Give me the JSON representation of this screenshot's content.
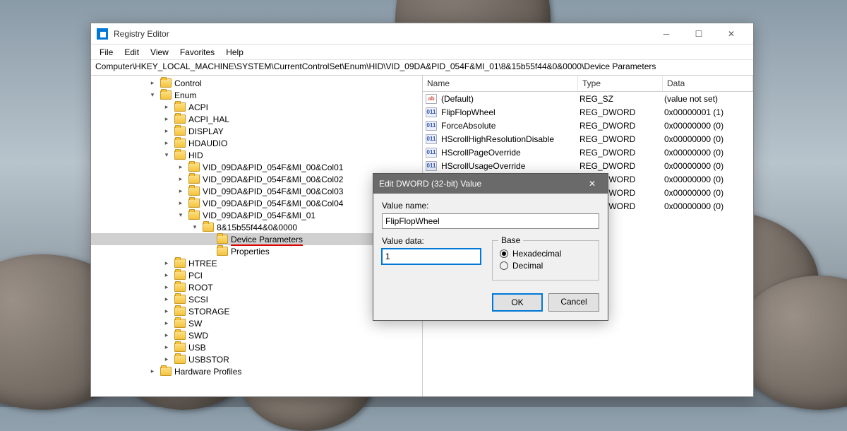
{
  "window": {
    "title": "Registry Editor",
    "menu": [
      "File",
      "Edit",
      "View",
      "Favorites",
      "Help"
    ],
    "path": "Computer\\HKEY_LOCAL_MACHINE\\SYSTEM\\CurrentControlSet\\Enum\\HID\\VID_09DA&PID_054F&MI_01\\8&15b55f44&0&0000\\Device Parameters"
  },
  "tree": {
    "root_indent": 60,
    "items": [
      {
        "label": "Control",
        "indent": 80,
        "toggle": "▸"
      },
      {
        "label": "Enum",
        "indent": 80,
        "toggle": "▾"
      },
      {
        "label": "ACPI",
        "indent": 100,
        "toggle": "▸"
      },
      {
        "label": "ACPI_HAL",
        "indent": 100,
        "toggle": "▸"
      },
      {
        "label": "DISPLAY",
        "indent": 100,
        "toggle": "▸"
      },
      {
        "label": "HDAUDIO",
        "indent": 100,
        "toggle": "▸"
      },
      {
        "label": "HID",
        "indent": 100,
        "toggle": "▾"
      },
      {
        "label": "VID_09DA&PID_054F&MI_00&Col01",
        "indent": 120,
        "toggle": "▸"
      },
      {
        "label": "VID_09DA&PID_054F&MI_00&Col02",
        "indent": 120,
        "toggle": "▸"
      },
      {
        "label": "VID_09DA&PID_054F&MI_00&Col03",
        "indent": 120,
        "toggle": "▸"
      },
      {
        "label": "VID_09DA&PID_054F&MI_00&Col04",
        "indent": 120,
        "toggle": "▸"
      },
      {
        "label": "VID_09DA&PID_054F&MI_01",
        "indent": 120,
        "toggle": "▾"
      },
      {
        "label": "8&15b55f44&0&0000",
        "indent": 140,
        "toggle": "▾"
      },
      {
        "label": "Device Parameters",
        "indent": 160,
        "toggle": " ",
        "selected": true,
        "underline": true
      },
      {
        "label": "Properties",
        "indent": 160,
        "toggle": " "
      },
      {
        "label": "HTREE",
        "indent": 100,
        "toggle": "▸"
      },
      {
        "label": "PCI",
        "indent": 100,
        "toggle": "▸"
      },
      {
        "label": "ROOT",
        "indent": 100,
        "toggle": "▸"
      },
      {
        "label": "SCSI",
        "indent": 100,
        "toggle": "▸"
      },
      {
        "label": "STORAGE",
        "indent": 100,
        "toggle": "▸"
      },
      {
        "label": "SW",
        "indent": 100,
        "toggle": "▸"
      },
      {
        "label": "SWD",
        "indent": 100,
        "toggle": "▸"
      },
      {
        "label": "USB",
        "indent": 100,
        "toggle": "▸"
      },
      {
        "label": "USBSTOR",
        "indent": 100,
        "toggle": "▸"
      },
      {
        "label": "Hardware Profiles",
        "indent": 80,
        "toggle": "▸",
        "cut": true
      }
    ]
  },
  "list": {
    "headers": {
      "name": "Name",
      "type": "Type",
      "data": "Data"
    },
    "rows": [
      {
        "icon": "str",
        "name": "(Default)",
        "type": "REG_SZ",
        "data": "(value not set)"
      },
      {
        "icon": "dword",
        "name": "FlipFlopWheel",
        "type": "REG_DWORD",
        "data": "0x00000001 (1)",
        "underline": true
      },
      {
        "icon": "dword",
        "name": "ForceAbsolute",
        "type": "REG_DWORD",
        "data": "0x00000000 (0)"
      },
      {
        "icon": "dword",
        "name": "HScrollHighResolutionDisable",
        "type": "REG_DWORD",
        "data": "0x00000000 (0)"
      },
      {
        "icon": "dword",
        "name": "HScrollPageOverride",
        "type": "REG_DWORD",
        "data": "0x00000000 (0)"
      },
      {
        "icon": "dword",
        "name": "HScrollUsageOverride",
        "type": "REG_DWORD",
        "data": "0x00000000 (0)"
      },
      {
        "icon": "dword",
        "name": "",
        "type": "REG_DWORD",
        "data": "0x00000000 (0)"
      },
      {
        "icon": "dword",
        "name": "",
        "type": "REG_DWORD",
        "data": "0x00000000 (0)"
      },
      {
        "icon": "dword",
        "name": "",
        "type": "REG_DWORD",
        "data": "0x00000000 (0)"
      }
    ]
  },
  "dialog": {
    "title": "Edit DWORD (32-bit) Value",
    "value_name_label": "Value name:",
    "value_name": "FlipFlopWheel",
    "value_data_label": "Value data:",
    "value_data": "1",
    "base_label": "Base",
    "hex_label": "Hexadecimal",
    "dec_label": "Decimal",
    "ok": "OK",
    "cancel": "Cancel"
  }
}
